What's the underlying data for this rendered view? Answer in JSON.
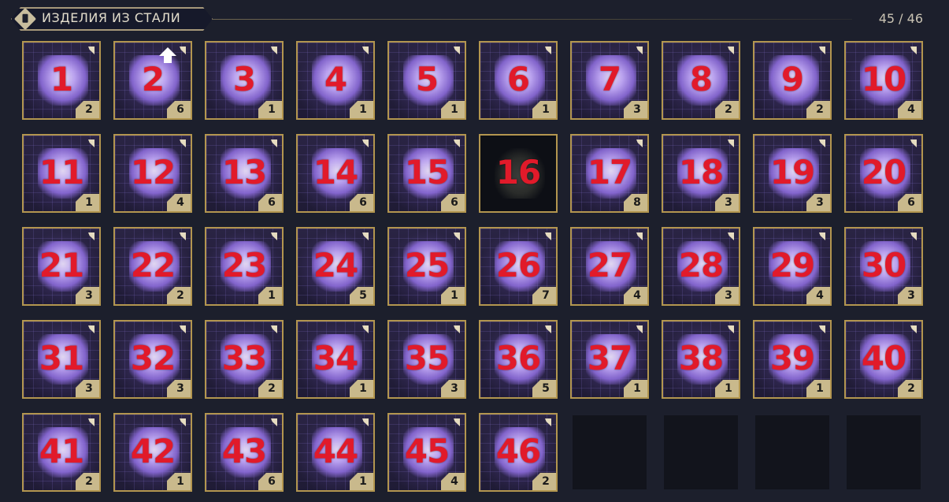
{
  "header": {
    "title": "ИЗДЕЛИЯ ИЗ СТАЛИ",
    "count": "45 / 46",
    "icon": "back-arrow-diamond-icon"
  },
  "colors": {
    "background": "#1c1f2c",
    "slot_border": "#b3964f",
    "number_label": "#e11a2a",
    "quantity_badge": "#c9b98c",
    "item_glow": "#c9b0ff"
  },
  "items": [
    {
      "num": "1",
      "qty": "2",
      "icon": "chest-plate-icon"
    },
    {
      "num": "2",
      "qty": "6",
      "icon": "cube-armor-icon",
      "upgrade": true
    },
    {
      "num": "3",
      "qty": "1",
      "icon": "box-armor-icon"
    },
    {
      "num": "4",
      "qty": "1",
      "icon": "helmet-icon"
    },
    {
      "num": "5",
      "qty": "1",
      "icon": "gauntlet-icon"
    },
    {
      "num": "6",
      "qty": "1",
      "icon": "boots-icon"
    },
    {
      "num": "7",
      "qty": "3",
      "icon": "boots-icon"
    },
    {
      "num": "8",
      "qty": "2",
      "icon": "boots-icon"
    },
    {
      "num": "9",
      "qty": "2",
      "icon": "spear-icon"
    },
    {
      "num": "10",
      "qty": "4",
      "icon": "shield-icon"
    },
    {
      "num": "11",
      "qty": "1",
      "icon": "pauldron-icon"
    },
    {
      "num": "12",
      "qty": "4",
      "icon": "jacket-icon"
    },
    {
      "num": "13",
      "qty": "6",
      "icon": "rifle-icon"
    },
    {
      "num": "14",
      "qty": "6",
      "icon": "rifle-icon"
    },
    {
      "num": "15",
      "qty": "6",
      "icon": "armor-vest-icon"
    },
    {
      "num": "16",
      "qty": "",
      "icon": "silhouette-icon",
      "dark": true
    },
    {
      "num": "17",
      "qty": "8",
      "icon": "blade-icon"
    },
    {
      "num": "18",
      "qty": "3",
      "icon": "blade-icon"
    },
    {
      "num": "19",
      "qty": "3",
      "icon": "rifle-icon"
    },
    {
      "num": "20",
      "qty": "6",
      "icon": "armor-vest-icon"
    },
    {
      "num": "21",
      "qty": "3",
      "icon": "axe-icon"
    },
    {
      "num": "22",
      "qty": "2",
      "icon": "helmet-icon"
    },
    {
      "num": "23",
      "qty": "1",
      "icon": "box-armor-icon"
    },
    {
      "num": "24",
      "qty": "5",
      "icon": "rifle-icon"
    },
    {
      "num": "25",
      "qty": "1",
      "icon": "rifle-icon"
    },
    {
      "num": "26",
      "qty": "7",
      "icon": "scythe-icon"
    },
    {
      "num": "27",
      "qty": "4",
      "icon": "gauntlet-icon"
    },
    {
      "num": "28",
      "qty": "3",
      "icon": "gauntlet-icon"
    },
    {
      "num": "29",
      "qty": "4",
      "icon": "gauntlet-icon"
    },
    {
      "num": "30",
      "qty": "3",
      "icon": "rifle-icon"
    },
    {
      "num": "31",
      "qty": "3",
      "icon": "pistol-icon"
    },
    {
      "num": "32",
      "qty": "3",
      "icon": "armor-vest-icon"
    },
    {
      "num": "33",
      "qty": "2",
      "icon": "rifle-icon"
    },
    {
      "num": "34",
      "qty": "1",
      "icon": "gauntlet-icon"
    },
    {
      "num": "35",
      "qty": "3",
      "icon": "rifle-icon"
    },
    {
      "num": "36",
      "qty": "5",
      "icon": "rifle-icon"
    },
    {
      "num": "37",
      "qty": "1",
      "icon": "armor-vest-icon"
    },
    {
      "num": "38",
      "qty": "1",
      "icon": "helmet-icon"
    },
    {
      "num": "39",
      "qty": "1",
      "icon": "boots-icon"
    },
    {
      "num": "40",
      "qty": "2",
      "icon": "gauntlet-icon"
    },
    {
      "num": "41",
      "qty": "2",
      "icon": "pants-icon"
    },
    {
      "num": "42",
      "qty": "1",
      "icon": "helmet-icon"
    },
    {
      "num": "43",
      "qty": "6",
      "icon": "pants-icon"
    },
    {
      "num": "44",
      "qty": "1",
      "icon": "sword-icon"
    },
    {
      "num": "45",
      "qty": "4",
      "icon": "blade-icon"
    },
    {
      "num": "46",
      "qty": "2",
      "icon": "gauntlet-icon"
    }
  ],
  "empty_slots": 4
}
